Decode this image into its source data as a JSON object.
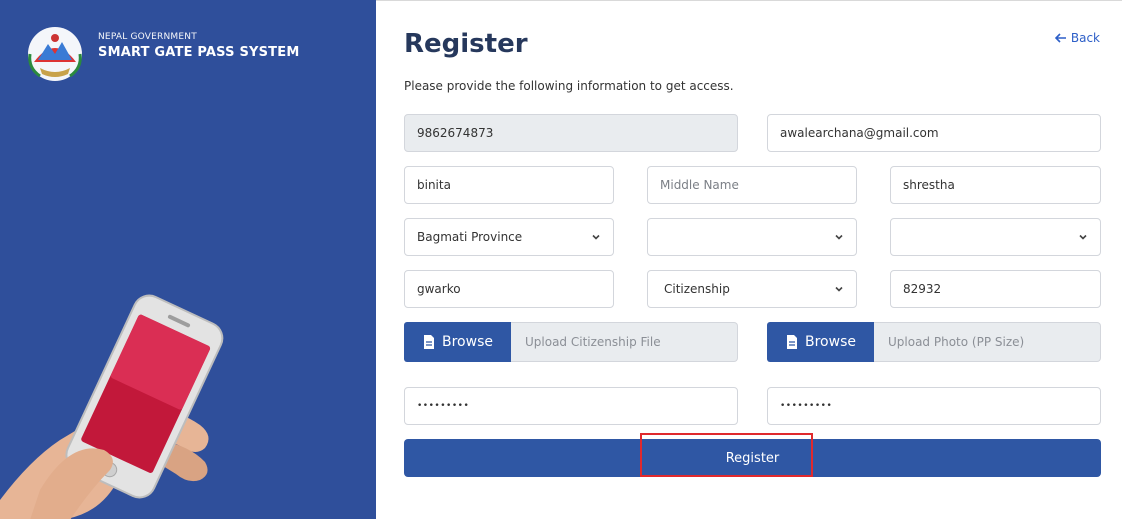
{
  "brand": {
    "subtitle": "NEPAL GOVERNMENT",
    "title": "SMART GATE PASS SYSTEM"
  },
  "form": {
    "title": "Register",
    "subtitle": "Please provide the following information to get access.",
    "back_label": "Back",
    "phone": "9862674873",
    "email": "awalearchana@gmail.com",
    "first_name": "binita",
    "middle_name_placeholder": "Middle Name",
    "last_name": "shrestha",
    "province": "Bagmati Province",
    "district": "",
    "municipality": "",
    "address": "gwarko",
    "document_type": "Citizenship",
    "document_number": "82932",
    "browse_label_1": "Browse",
    "citizenship_file_placeholder": "Upload Citizenship File",
    "browse_label_2": "Browse",
    "photo_placeholder": "Upload Photo (PP Size)",
    "password": "•••••••••",
    "confirm_password": "•••••••••",
    "submit_label": "Register"
  },
  "colors": {
    "sidebar": "#2f4f9b",
    "primary": "#2f57a4",
    "highlight": "#e0292d"
  }
}
